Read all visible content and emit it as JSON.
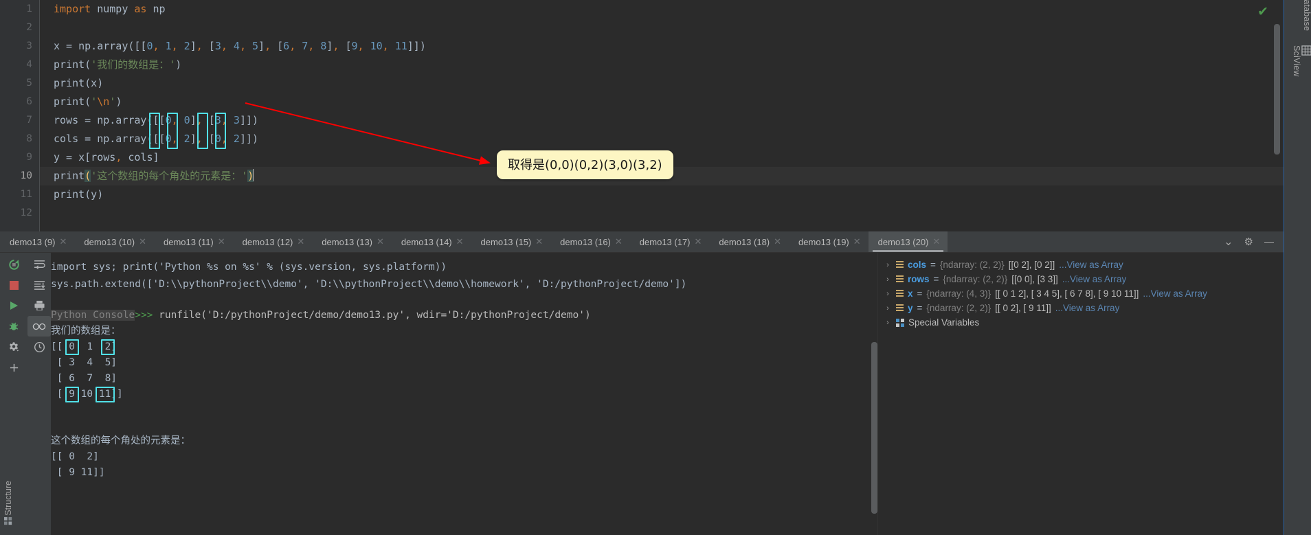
{
  "editor": {
    "lines": [
      {
        "n": 1,
        "text": "import numpy as np"
      },
      {
        "n": 2,
        "text": ""
      },
      {
        "n": 3,
        "text": "x = np.array([[0, 1, 2], [3, 4, 5], [6, 7, 8], [9, 10, 11]])"
      },
      {
        "n": 4,
        "text": "print('我们的数组是：')"
      },
      {
        "n": 5,
        "text": "print(x)"
      },
      {
        "n": 6,
        "text": "print('\\n')"
      },
      {
        "n": 7,
        "text": "rows = np.array([[0, 0], [3, 3]])"
      },
      {
        "n": 8,
        "text": "cols = np.array([[0, 2], [0, 2]])"
      },
      {
        "n": 9,
        "text": "y = x[rows, cols]"
      },
      {
        "n": 10,
        "text": "print('这个数组的每个角处的元素是：')"
      },
      {
        "n": 11,
        "text": "print(y)"
      },
      {
        "n": 12,
        "text": ""
      }
    ],
    "current_line": 10,
    "annotation": {
      "callout_text": "取得是(0,0)(0,2)(3,0)(3,2)",
      "callout_bg": "#fdf6c3",
      "arrow_color": "#ff0000",
      "highlight_color": "#51e1e8",
      "highlighted_values": [
        "0",
        "0",
        "3",
        "3",
        "0",
        "2",
        "0",
        "2"
      ]
    },
    "status_check": "✔"
  },
  "right_rail": {
    "tabs": [
      {
        "label": "Database",
        "icon": "database-icon"
      },
      {
        "label": "SciView",
        "icon": "grid-icon"
      }
    ]
  },
  "left_rail": {
    "structure_label": "Structure",
    "structure_icon": "structure-icon"
  },
  "tabbar": {
    "tabs": [
      {
        "label": "demo13 (9)",
        "active": false
      },
      {
        "label": "demo13 (10)",
        "active": false
      },
      {
        "label": "demo13 (11)",
        "active": false
      },
      {
        "label": "demo13 (12)",
        "active": false
      },
      {
        "label": "demo13 (13)",
        "active": false
      },
      {
        "label": "demo13 (14)",
        "active": false
      },
      {
        "label": "demo13 (15)",
        "active": false
      },
      {
        "label": "demo13 (16)",
        "active": false
      },
      {
        "label": "demo13 (17)",
        "active": false
      },
      {
        "label": "demo13 (18)",
        "active": false
      },
      {
        "label": "demo13 (19)",
        "active": false
      },
      {
        "label": "demo13 (20)",
        "active": true
      }
    ],
    "close_glyph": "✕",
    "controls": [
      {
        "name": "chevron-down-icon",
        "glyph": "⌄"
      },
      {
        "name": "gear-icon",
        "glyph": "⚙"
      },
      {
        "name": "minimize-icon",
        "glyph": "—"
      }
    ]
  },
  "console": {
    "toolbar_primary": [
      {
        "name": "rerun-icon",
        "color": "#59a869"
      },
      {
        "name": "stop-icon",
        "color": "#c75450"
      },
      {
        "name": "run-icon",
        "color": "#59a869"
      },
      {
        "name": "debug-icon",
        "color": "#59a869"
      },
      {
        "name": "settings-gear-icon",
        "color": "#afb1b3"
      },
      {
        "name": "add-icon",
        "color": "#afb1b3"
      }
    ],
    "toolbar_secondary": [
      {
        "name": "soft-wrap-icon",
        "color": "#afb1b3"
      },
      {
        "name": "scroll-to-end-icon",
        "color": "#afb1b3"
      },
      {
        "name": "print-icon",
        "color": "#afb1b3"
      },
      {
        "name": "view-glasses-icon",
        "color": "#afb1b3",
        "selected": true
      },
      {
        "name": "history-clock-icon",
        "color": "#afb1b3"
      }
    ],
    "output": {
      "line1": "import sys; print('Python %s on %s' % (sys.version, sys.platform))",
      "line2": "sys.path.extend(['D:\\\\pythonProject\\\\demo', 'D:\\\\pythonProject\\\\demo\\\\homework', 'D:/pythonProject/demo'])",
      "prompt_label": "Python Console",
      "prompt_caret": ">>>",
      "runfile_cmd": "runfile('D:/pythonProject/demo/demo13.py', wdir='D:/pythonProject/demo')",
      "heading1": "我们的数组是：",
      "array_rows": [
        "[[ 0  1  2]",
        " [ 3  4  5]",
        " [ 6  7  8]",
        " [ 9 10 11]]"
      ],
      "heading2": "这个数组的每个角处的元素是：",
      "result_rows": [
        "[[ 0  2]",
        " [ 9 11]]"
      ]
    }
  },
  "variables": {
    "rows": [
      {
        "chevron": "›",
        "icon": "array-icon",
        "name": "cols",
        "eq": " = ",
        "type": "{ndarray: (2, 2)}",
        "value": "[[0 2], [0 2]]",
        "link": "...View as Array"
      },
      {
        "chevron": "›",
        "icon": "array-icon",
        "name": "rows",
        "eq": " = ",
        "type": "{ndarray: (2, 2)}",
        "value": "[[0 0], [3 3]]",
        "link": "...View as Array"
      },
      {
        "chevron": "›",
        "icon": "array-icon",
        "name": "x",
        "eq": " = ",
        "type": "{ndarray: (4, 3)}",
        "value": "[[ 0  1  2], [ 3  4  5], [ 6  7  8], [ 9 10 11]]",
        "link": "...View as Array"
      },
      {
        "chevron": "›",
        "icon": "array-icon",
        "name": "y",
        "eq": " = ",
        "type": "{ndarray: (2, 2)}",
        "value": "[[ 0  2], [ 9 11]]",
        "link": "...View as Array"
      }
    ],
    "special": {
      "chevron": "›",
      "icon": "special-vars-icon",
      "label": "Special Variables"
    }
  }
}
